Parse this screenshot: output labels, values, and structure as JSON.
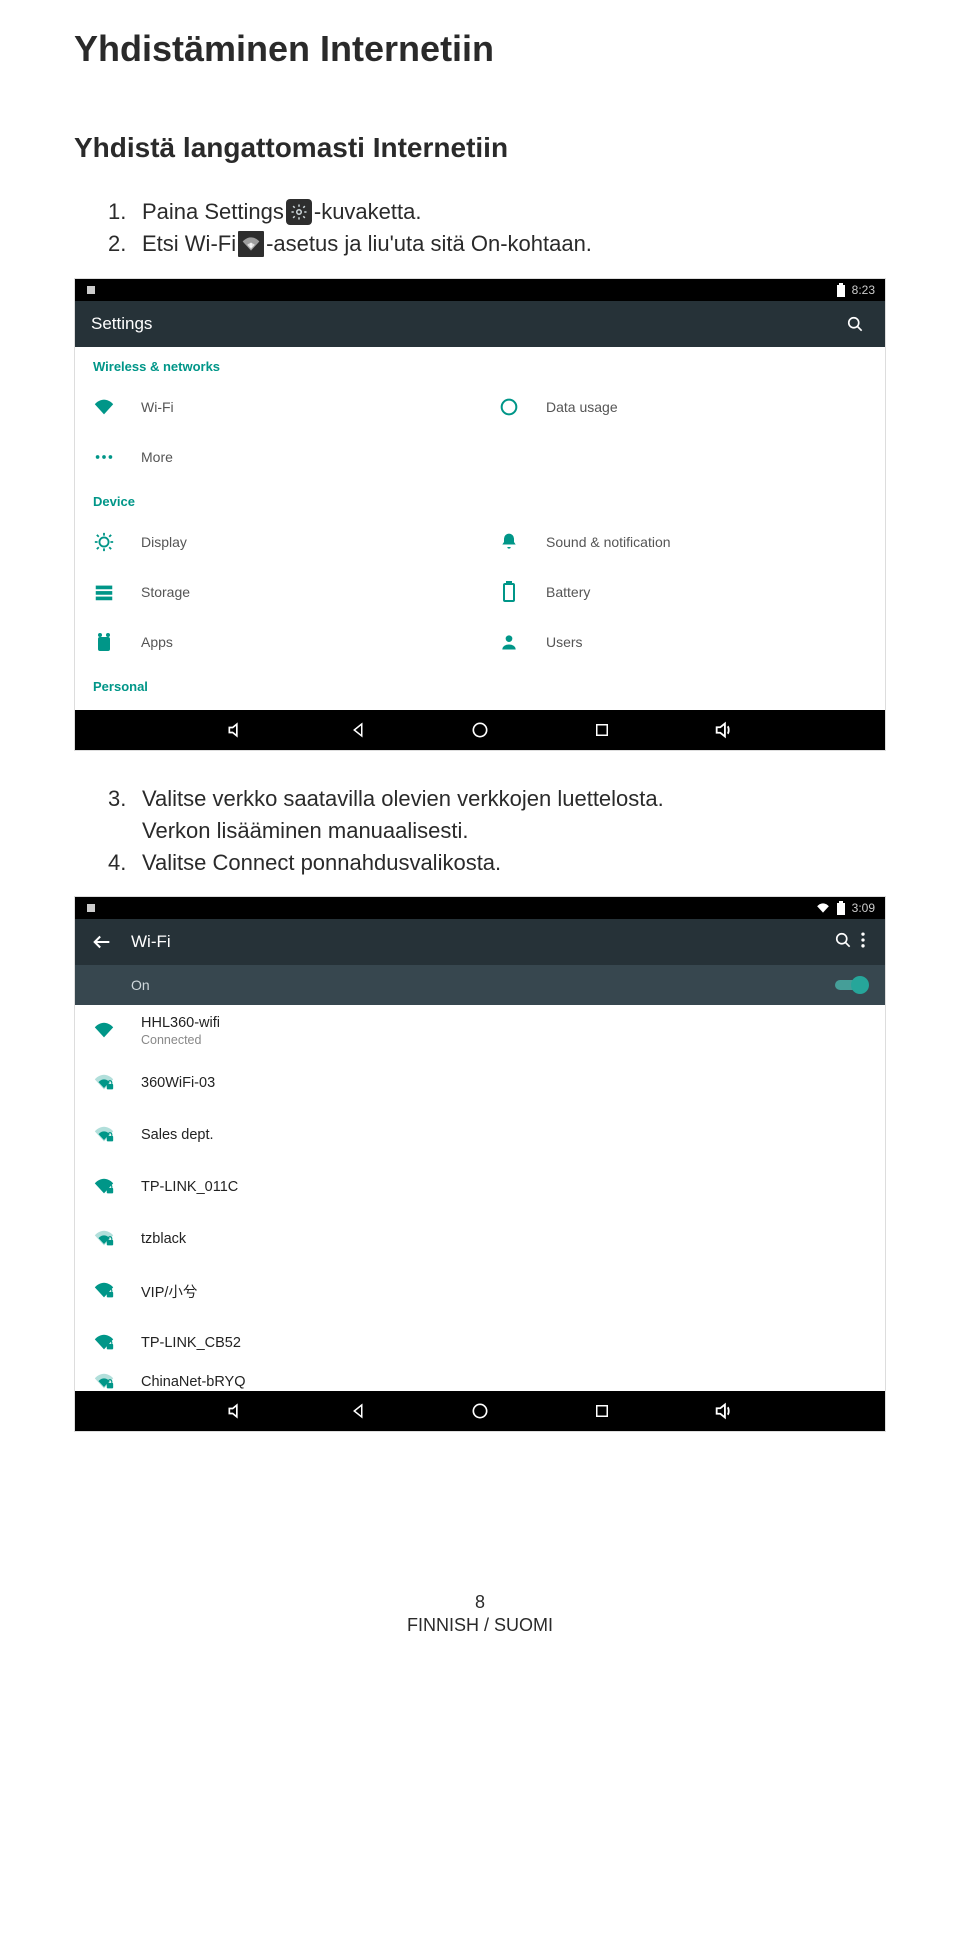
{
  "doc": {
    "title": "Yhdistäminen Internetiin",
    "subtitle": "Yhdistä langattomasti Internetiin",
    "steps": {
      "s1_num": "1.",
      "s1_a": "Paina Settings",
      "s1_b": "-kuvaketta.",
      "s2_num": "2.",
      "s2_a": "Etsi Wi-Fi",
      "s2_b": "-asetus ja liu'uta sitä On-kohtaan.",
      "s3_num": "3.",
      "s3": "Valitse verkko saatavilla olevien verkkojen luettelosta.",
      "s3b": "Verkon lisääminen manuaalisesti.",
      "s4_num": "4.",
      "s4": "Valitse Connect ponnahdusvalikosta."
    },
    "footer_page": "8",
    "footer_lang": "FINNISH / SUOMI"
  },
  "shot1": {
    "clock": "8:23",
    "title": "Settings",
    "sections": {
      "wireless": "Wireless & networks",
      "device": "Device",
      "personal": "Personal"
    },
    "items": {
      "wifi": "Wi-Fi",
      "data_usage": "Data usage",
      "more": "More",
      "display": "Display",
      "sound": "Sound & notification",
      "storage": "Storage",
      "battery": "Battery",
      "apps": "Apps",
      "users": "Users"
    }
  },
  "shot2": {
    "clock": "3:09",
    "title": "Wi-Fi",
    "on_label": "On",
    "networks": [
      {
        "name": "HHL360-wifi",
        "sub": "Connected",
        "lock": false,
        "strong": true
      },
      {
        "name": "360WiFi-03",
        "sub": "",
        "lock": true,
        "strong": false
      },
      {
        "name": "Sales dept.",
        "sub": "",
        "lock": true,
        "strong": false
      },
      {
        "name": "TP-LINK_011C",
        "sub": "",
        "lock": true,
        "strong": true
      },
      {
        "name": "tzblack",
        "sub": "",
        "lock": true,
        "strong": false
      },
      {
        "name": "VIP/小兮",
        "sub": "",
        "lock": true,
        "strong": true
      },
      {
        "name": "TP-LINK_CB52",
        "sub": "",
        "lock": true,
        "strong": true
      },
      {
        "name": "ChinaNet-bRYQ",
        "sub": "",
        "lock": true,
        "strong": false
      }
    ]
  }
}
